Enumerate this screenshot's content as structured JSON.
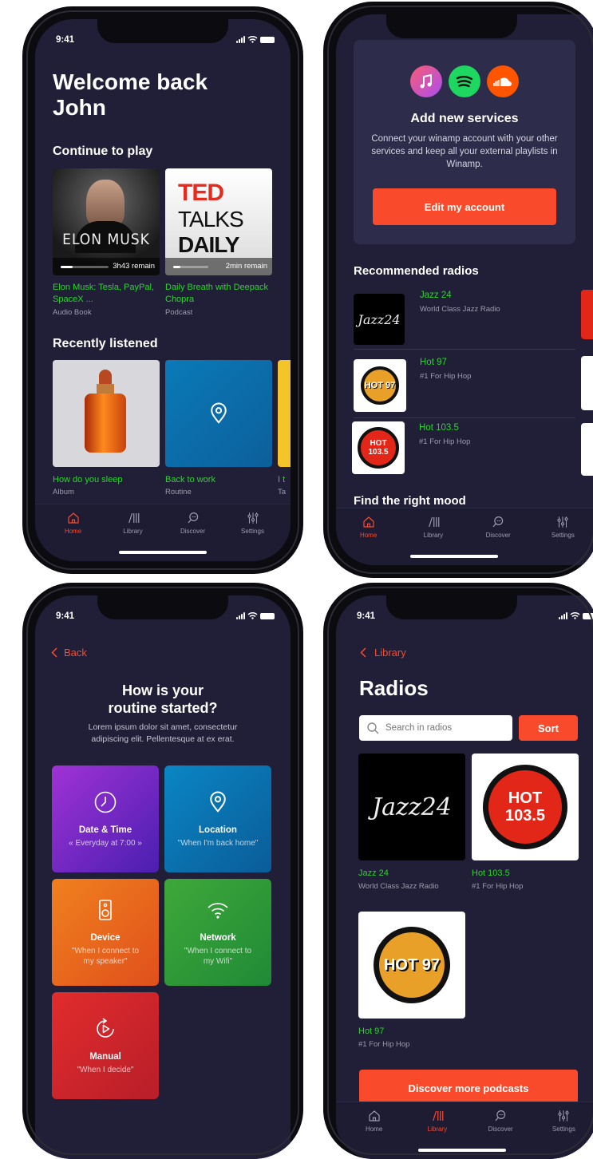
{
  "status_time": "9:41",
  "tabs": {
    "home": "Home",
    "library": "Library",
    "discover": "Discover",
    "settings": "Settings"
  },
  "screen1": {
    "welcome": "Welcome back John",
    "continue_title": "Continue to play",
    "continue_items": [
      {
        "cover_text": "ELON MUSK",
        "remaining": "3h43 remain",
        "progress": 0.25,
        "title": "Elon Musk: Tesla, PayPal, SpaceX ...",
        "type": "Audio Book"
      },
      {
        "cover_text_1": "TED",
        "cover_text_2": "TALKS",
        "cover_text_3": "DAILY",
        "remaining": "2min remain",
        "progress": 0.2,
        "title": "Daily Breath with Deepack Chopra",
        "type": "Podcast"
      }
    ],
    "recent_title": "Recently listened",
    "recent_items": [
      {
        "title": "How do you sleep",
        "type": "Album"
      },
      {
        "title": "Back to work",
        "type": "Routine"
      },
      {
        "title": "I t",
        "type": "Ta"
      }
    ]
  },
  "screen2": {
    "add_title": "Add new services",
    "add_desc": "Connect your winamp account with your other services and keep all your external playlists in Winamp.",
    "edit_button": "Edit my account",
    "recommended_title": "Recommended radios",
    "radios": [
      {
        "name": "Jazz 24",
        "desc": "World Class Jazz Radio",
        "logo": "Jazz24"
      },
      {
        "name": "Hot 97",
        "desc": "#1 For Hip Hop",
        "logo": "HOT 97"
      },
      {
        "name": "Hot 103.5",
        "desc": "#1 For Hip Hop",
        "logo": "HOT 103.5"
      }
    ],
    "mood_title": "Find the right mood"
  },
  "screen3": {
    "back": "Back",
    "title_line1": "How is your",
    "title_line2": "routine started?",
    "desc": "Lorem ipsum dolor sit amet, consectetur adipiscing elit. Pellentesque at ex erat.",
    "tiles": [
      {
        "title": "Date & Time",
        "sub": "« Everyday at 7:00 »"
      },
      {
        "title": "Location",
        "sub": "\"When I'm back home\""
      },
      {
        "title": "Device",
        "sub": "\"When I connect to my speaker\""
      },
      {
        "title": "Network",
        "sub": "\"When I connect to my Wifi\""
      },
      {
        "title": "Manual",
        "sub": "\"When I decide\""
      }
    ]
  },
  "screen4": {
    "back": "Library",
    "title": "Radios",
    "search_placeholder": "Search in radios",
    "sort": "Sort",
    "radios": [
      {
        "name": "Jazz 24",
        "desc": "World Class Jazz Radio",
        "logo": "Jazz24"
      },
      {
        "name": "Hot 103.5",
        "desc": "#1 For Hip Hop",
        "logo": "HOT 103.5"
      },
      {
        "name": "Hot 97",
        "desc": "#1 For Hip Hop",
        "logo": "HOT 97"
      }
    ],
    "bottom_button": "Discover more podcasts"
  },
  "colors": {
    "bg": "#201f37",
    "accent": "#fa4a2c",
    "green": "#2bd62b",
    "card": "#2d2c4a"
  }
}
